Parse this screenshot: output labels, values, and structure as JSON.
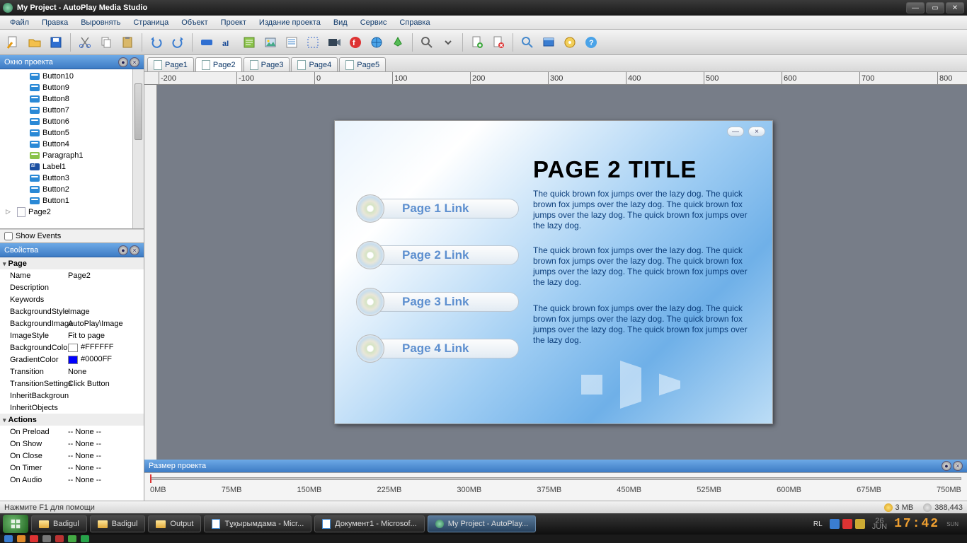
{
  "titlebar": {
    "title": "My Project - AutoPlay Media Studio"
  },
  "menu": [
    "Файл",
    "Правка",
    "Выровнять",
    "Страница",
    "Объект",
    "Проект",
    "Издание проекта",
    "Вид",
    "Сервис",
    "Справка"
  ],
  "panels": {
    "projectWindow": "Окно проекта",
    "properties": "Свойства",
    "projectSize": "Размер проекта"
  },
  "showEvents": "Show Events",
  "tree": {
    "items": [
      {
        "label": "Button10",
        "kind": "btn"
      },
      {
        "label": "Button9",
        "kind": "btn"
      },
      {
        "label": "Button8",
        "kind": "btn"
      },
      {
        "label": "Button7",
        "kind": "btn"
      },
      {
        "label": "Button6",
        "kind": "btn"
      },
      {
        "label": "Button5",
        "kind": "btn"
      },
      {
        "label": "Button4",
        "kind": "btn"
      },
      {
        "label": "Paragraph1",
        "kind": "para"
      },
      {
        "label": "Label1",
        "kind": "lbl"
      },
      {
        "label": "Button3",
        "kind": "btn"
      },
      {
        "label": "Button2",
        "kind": "btn"
      },
      {
        "label": "Button1",
        "kind": "btn"
      }
    ],
    "page": "Page2"
  },
  "props": {
    "groupPage": "Page",
    "rows": [
      {
        "k": "Name",
        "v": "Page2"
      },
      {
        "k": "Description",
        "v": ""
      },
      {
        "k": "Keywords",
        "v": ""
      },
      {
        "k": "BackgroundStyle",
        "v": "Image"
      },
      {
        "k": "BackgroundImage",
        "v": "AutoPlay\\Image"
      },
      {
        "k": "ImageStyle",
        "v": "Fit to page"
      },
      {
        "k": "BackgroundColor",
        "v": "#FFFFFF",
        "swatch": "#FFFFFF"
      },
      {
        "k": "GradientColor",
        "v": "#0000FF",
        "swatch": "#0000FF"
      },
      {
        "k": "Transition",
        "v": "None"
      },
      {
        "k": "TransitionSettings",
        "v": "Click Button"
      },
      {
        "k": "InheritBackgroun",
        "v": ""
      },
      {
        "k": "InheritObjects",
        "v": ""
      }
    ],
    "groupActions": "Actions",
    "actionRows": [
      {
        "k": "On Preload",
        "v": "-- None --"
      },
      {
        "k": "On Show",
        "v": "-- None --"
      },
      {
        "k": "On Close",
        "v": "-- None --"
      },
      {
        "k": "On Timer",
        "v": "-- None --"
      },
      {
        "k": "On Audio",
        "v": "-- None --"
      }
    ]
  },
  "tabs": [
    "Page1",
    "Page2",
    "Page3",
    "Page4",
    "Page5"
  ],
  "activeTab": 1,
  "rulerH": [
    "-200",
    "-100",
    "0",
    "100",
    "200",
    "300",
    "400",
    "500",
    "600",
    "700",
    "800"
  ],
  "design": {
    "title": "PAGE 2 TITLE",
    "paragraph": "The quick brown fox jumps over the lazy dog. The quick brown fox jumps over the lazy dog. The quick brown fox jumps over the lazy dog. The quick brown fox jumps over the lazy dog.",
    "buttons": [
      "Page 1 Link",
      "Page 2 Link",
      "Page 3 Link",
      "Page 4 Link"
    ]
  },
  "sizeStrip": [
    "0MB",
    "75MB",
    "150MB",
    "225MB",
    "300MB",
    "375MB",
    "450MB",
    "525MB",
    "600MB",
    "675MB",
    "750MB"
  ],
  "status": {
    "help": "Нажмите F1 для помощи",
    "size": "3 MB",
    "bytes": "388,443"
  },
  "taskbar": {
    "items": [
      {
        "label": "Badigul",
        "icon": "fld"
      },
      {
        "label": "Badigul",
        "icon": "fld"
      },
      {
        "label": "Output",
        "icon": "fld"
      },
      {
        "label": "Тұқырымдама - Micr...",
        "icon": "doc"
      },
      {
        "label": "Документ1 - Microsof...",
        "icon": "doc"
      },
      {
        "label": "My Project - AutoPlay...",
        "icon": "app",
        "active": true
      }
    ],
    "lang": "RL",
    "date": {
      "day": "26",
      "mon": "JUN",
      "dow": "SUN"
    },
    "clock": "17:42"
  }
}
